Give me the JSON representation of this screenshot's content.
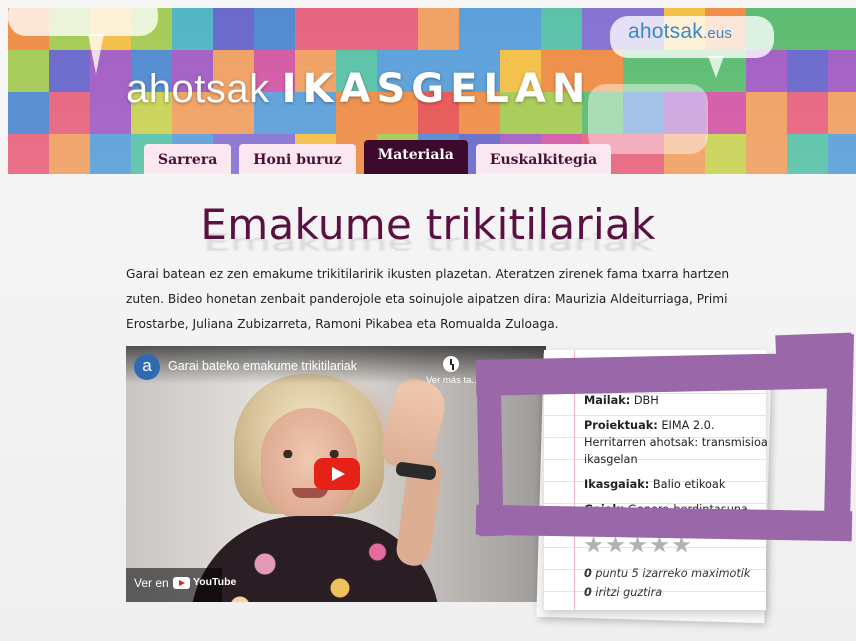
{
  "header": {
    "brand_site": "ahotsak",
    "brand_site_suffix": ".eus",
    "logo_part1": "ahotsak",
    "logo_part2": "IKASGELAN"
  },
  "nav": {
    "tabs": [
      {
        "label": "Sarrera",
        "active": false
      },
      {
        "label": "Honi buruz",
        "active": false
      },
      {
        "label": "Materiala",
        "active": true
      },
      {
        "label": "Euskalkitegia",
        "active": false
      }
    ]
  },
  "main": {
    "title": "Emakume trikitilariak",
    "intro": "Garai batean ez zen emakume trikitilaririk ikusten plazetan. Ateratzen zirenek fama txarra hartzen zuten. Bideo honetan zenbait panderojole eta soinujole aipatzen dira: Maurizia Aldeiturriaga, Primi Erostarbe, Juliana Zubizarreta, Ramoni Pikabea eta Romualda Zuloaga."
  },
  "video": {
    "channel_initial": "a",
    "title": "Garai bateko emakume trikitilariak",
    "watch_later": "Ver más ta...",
    "watch_on": "Ver en",
    "platform": "YouTube"
  },
  "details": {
    "mailak_label": "Mailak:",
    "mailak_value": "DBH",
    "proiektuak_label": "Proiektuak:",
    "proiektuak_value": "EIMA 2.0. Herritarren ahotsak: transmisioa ikasgelan",
    "ikasgaiak_label": "Ikasgaiak:",
    "ikasgaiak_value": "Balio etikoak",
    "gaiak_label": "Gaiak:",
    "gaiak_value": "Genero-berdintasuna, Aisialdia",
    "rating_stars": 0,
    "rating_count": "0",
    "rating_text": "puntu 5 izarreko maximotik",
    "reviews_count": "0",
    "reviews_text": "iritzi guztira"
  },
  "colors": {
    "tab_active_bg": "#3e0a2c",
    "tab_bg": "#fbe7ef",
    "title": "#5a1040",
    "highlight": "#9a68a8",
    "play_button": "#e62117"
  }
}
